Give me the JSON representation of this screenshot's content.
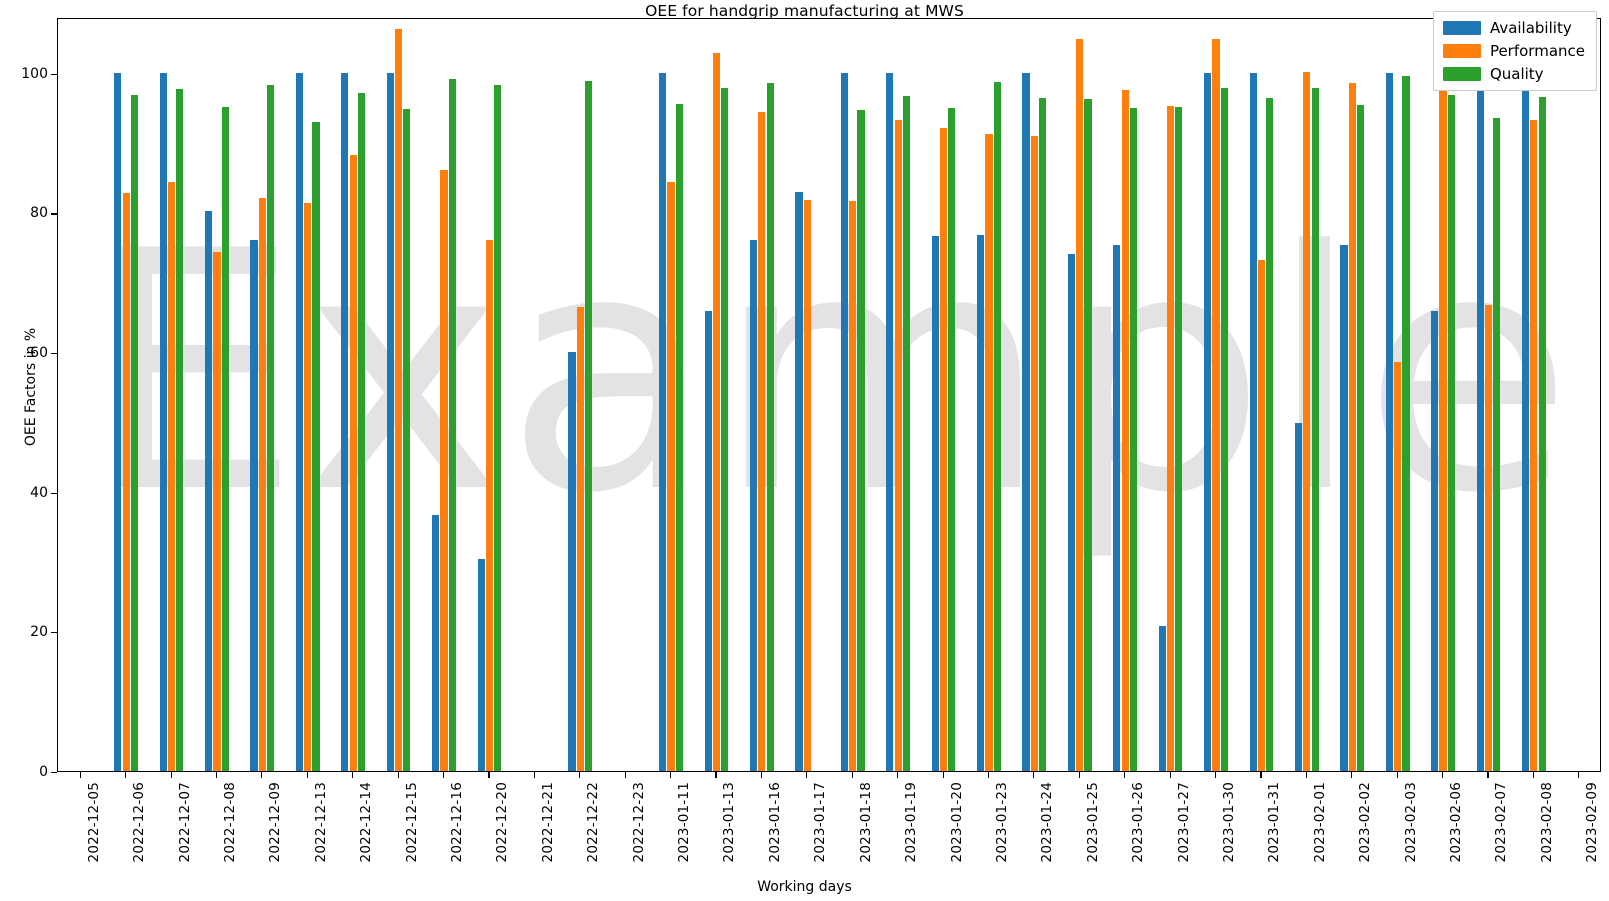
{
  "chart_data": {
    "type": "bar",
    "title": "OEE for handgrip manufacturing at MWS",
    "xlabel": "Working days",
    "ylabel": "OEE Factors in %",
    "ylim": [
      0,
      108
    ],
    "yticks": [
      0,
      20,
      40,
      60,
      80,
      100
    ],
    "grid": false,
    "legend_position": "upper right",
    "watermark": "Example",
    "colors": {
      "availability": "#1f77b4",
      "performance": "#ff7f0e",
      "quality": "#2ca02c"
    },
    "categories": [
      "2022-12-05",
      "2022-12-06",
      "2022-12-07",
      "2022-12-08",
      "2022-12-09",
      "2022-12-13",
      "2022-12-14",
      "2022-12-15",
      "2022-12-16",
      "2022-12-20",
      "2022-12-21",
      "2022-12-22",
      "2022-12-23",
      "2023-01-11",
      "2023-01-13",
      "2023-01-16",
      "2023-01-17",
      "2023-01-18",
      "2023-01-19",
      "2023-01-20",
      "2023-01-23",
      "2023-01-24",
      "2023-01-25",
      "2023-01-26",
      "2023-01-27",
      "2023-01-30",
      "2023-01-31",
      "2023-02-01",
      "2023-02-02",
      "2023-02-03",
      "2023-02-06",
      "2023-02-07",
      "2023-02-08",
      "2023-02-09"
    ],
    "series": [
      {
        "name": "Availability",
        "color": "#1f77b4",
        "values": [
          0,
          100,
          100,
          80.2,
          76.0,
          100,
          100,
          100,
          36.7,
          30.3,
          0,
          60.0,
          0,
          100,
          65.9,
          76.0,
          82.9,
          100,
          100,
          76.6,
          76.8,
          100,
          74.1,
          75.4,
          20.8,
          100,
          100,
          49.9,
          75.3,
          100,
          65.9,
          100,
          100,
          0
        ]
      },
      {
        "name": "Performance",
        "color": "#ff7f0e",
        "values": [
          0,
          82.8,
          84.3,
          74.4,
          82.1,
          81.4,
          88.3,
          106.3,
          86.1,
          76.1,
          0,
          66.4,
          0,
          84.3,
          102.9,
          94.4,
          81.8,
          81.7,
          93.3,
          92.1,
          91.2,
          91.0,
          104.9,
          97.5,
          95.2,
          104.8,
          73.2,
          100.1,
          98.5,
          58.6,
          102.8,
          66.7,
          93.2,
          0
        ]
      },
      {
        "name": "Quality",
        "color": "#2ca02c",
        "values": [
          0,
          96.9,
          97.7,
          95.1,
          98.3,
          92.9,
          97.1,
          94.8,
          99.1,
          98.2,
          0,
          98.8,
          0,
          95.6,
          97.9,
          98.5,
          0,
          94.7,
          96.7,
          95.0,
          98.7,
          96.4,
          96.3,
          95.0,
          95.1,
          97.8,
          96.4,
          97.9,
          95.4,
          99.6,
          96.8,
          93.5,
          96.6,
          0
        ]
      }
    ]
  },
  "legend": {
    "items": [
      {
        "label": "Availability",
        "key": "availability"
      },
      {
        "label": "Performance",
        "key": "performance"
      },
      {
        "label": "Quality",
        "key": "quality"
      }
    ]
  }
}
